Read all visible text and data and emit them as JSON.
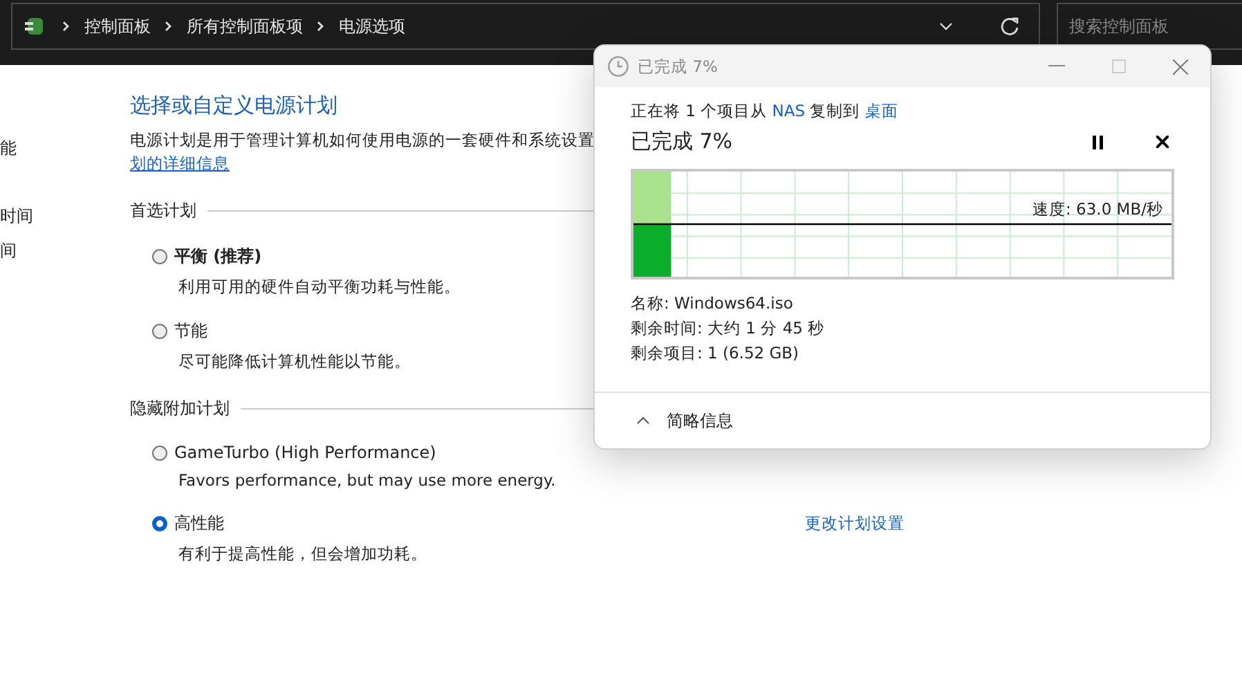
{
  "address_bar": {
    "breadcrumbs": [
      "控制面板",
      "所有控制面板项",
      "电源选项"
    ]
  },
  "search": {
    "placeholder": "搜索控制面板"
  },
  "sidebar": {
    "items": [
      "能",
      "时间",
      "间"
    ]
  },
  "main": {
    "title": "选择或自定义电源计划",
    "description": "电源计划是用于管理计算机如何使用电源的一套硬件和系统设置",
    "link": "划的详细信息",
    "groups": [
      {
        "heading": "首选计划",
        "plans": [
          {
            "name": "平衡 (推荐)",
            "bold": true,
            "description": "利用可用的硬件自动平衡功耗与性能。",
            "selected": false
          },
          {
            "name": "节能",
            "bold": false,
            "description": "尽可能降低计算机性能以节能。",
            "selected": false
          }
        ]
      },
      {
        "heading": "隐藏附加计划",
        "plans": [
          {
            "name": "GameTurbo (High Performance)",
            "bold": false,
            "description": "Favors performance, but may use more energy.",
            "selected": false
          },
          {
            "name": "高性能",
            "bold": false,
            "description": "有利于提高性能，但会增加功耗。",
            "selected": true,
            "settings_link": "更改计划设置"
          }
        ]
      }
    ]
  },
  "dialog": {
    "title": "已完成 7%",
    "copy_line": [
      "正在将 1 个项目从 ",
      "NAS",
      " 复制到 ",
      "桌面"
    ],
    "progress_title": "已完成 7%",
    "level": 0.07,
    "speed": "速度: 63.0 MB/秒",
    "details": [
      "名称: Windows64.iso",
      "剩余时间: 大约 1 分 45 秒",
      "剩余项目: 1 (6.52 GB)"
    ],
    "toggle": "简略信息"
  }
}
